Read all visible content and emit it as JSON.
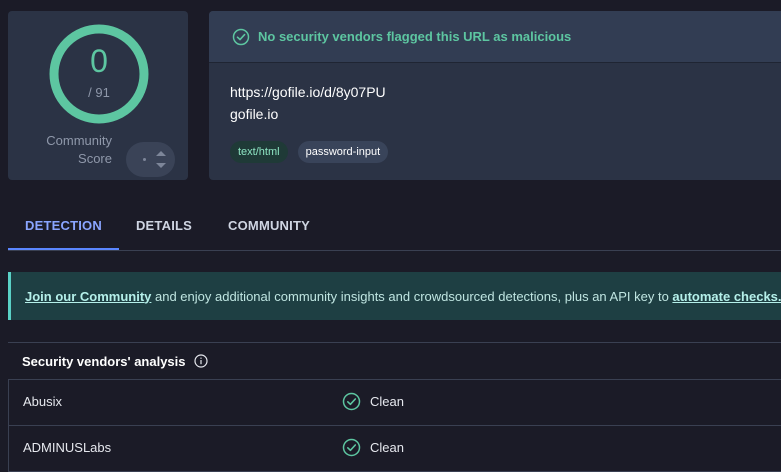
{
  "score": {
    "value": "0",
    "total": "/ 91",
    "detections": 0,
    "vendors": 91,
    "community_label_line1": "Community",
    "community_label_line2": "Score"
  },
  "colors": {
    "clean": "#5dc6a1",
    "accent": "#5b86ff",
    "background": "#1b1b27",
    "card": "#2b3345"
  },
  "banner": {
    "icon": "check-circle-icon",
    "text": "No security vendors flagged this URL as malicious"
  },
  "target": {
    "url": "https://gofile.io/d/8y07PU",
    "domain": "gofile.io",
    "tags": [
      "text/html",
      "password-input"
    ]
  },
  "tabs": [
    {
      "label": "DETECTION",
      "active": true
    },
    {
      "label": "DETAILS",
      "active": false
    },
    {
      "label": "COMMUNITY",
      "active": false
    }
  ],
  "join": {
    "link1": "Join our Community",
    "middle": " and enjoy additional community insights and crowdsourced detections, plus an API key to ",
    "link2": "automate checks."
  },
  "analysis": {
    "title": "Security vendors' analysis",
    "info_icon": "info-icon",
    "rows": [
      {
        "vendor": "Abusix",
        "verdict": "Clean"
      },
      {
        "vendor": "ADMINUSLabs",
        "verdict": "Clean"
      }
    ]
  }
}
